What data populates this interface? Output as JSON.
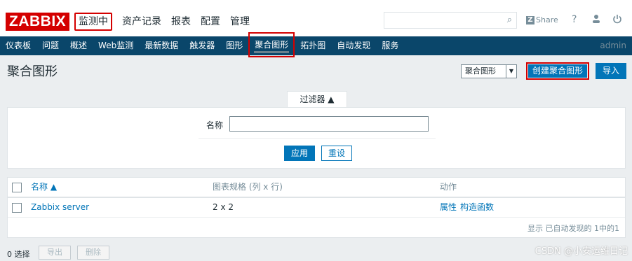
{
  "header": {
    "logo": "ZABBIX",
    "main_menu": [
      "监测中",
      "资产记录",
      "报表",
      "配置",
      "管理"
    ],
    "share_label": "Share",
    "help_label": "?"
  },
  "submenu": {
    "items": [
      "仪表板",
      "问题",
      "概述",
      "Web监测",
      "最新数据",
      "触发器",
      "图形",
      "聚合图形",
      "拓扑图",
      "自动发现",
      "服务"
    ],
    "user": "admin"
  },
  "page": {
    "title": "聚合图形",
    "type_select": "聚合图形",
    "create_button": "创建聚合图形",
    "import_button": "导入"
  },
  "filter": {
    "tab_label": "过滤器 ▲",
    "name_label": "名称",
    "name_value": "",
    "apply_button": "应用",
    "reset_button": "重设"
  },
  "table": {
    "headers": {
      "name": "名称 ▲",
      "size": "图表规格 (列 x 行)",
      "actions": "动作"
    },
    "rows": [
      {
        "name": "Zabbix server",
        "size": "2 x 2",
        "action1": "属性",
        "action2": "构造函数"
      }
    ],
    "footer": "显示 已自动发现的 1中的1"
  },
  "bottom": {
    "selected": "0 选择",
    "export_button": "导出",
    "delete_button": "删除"
  },
  "watermark": "CSDN @小安运维日记"
}
